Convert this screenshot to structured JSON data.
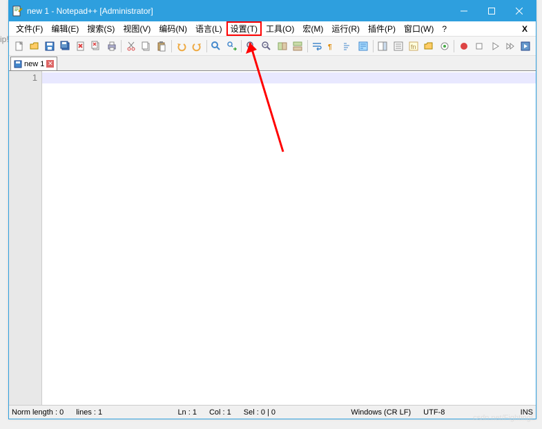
{
  "window": {
    "title": "new 1 - Notepad++ [Administrator]"
  },
  "menubar": {
    "items": [
      {
        "label": "文件(F)"
      },
      {
        "label": "编辑(E)"
      },
      {
        "label": "搜索(S)"
      },
      {
        "label": "视图(V)"
      },
      {
        "label": "编码(N)"
      },
      {
        "label": "语言(L)"
      },
      {
        "label": "设置(T)",
        "highlighted": true
      },
      {
        "label": "工具(O)"
      },
      {
        "label": "宏(M)"
      },
      {
        "label": "运行(R)"
      },
      {
        "label": "插件(P)"
      },
      {
        "label": "窗口(W)"
      },
      {
        "label": "?"
      }
    ],
    "close_x": "X"
  },
  "toolbar_icons": [
    "new",
    "open",
    "save",
    "save-all",
    "close",
    "close-all",
    "print",
    "",
    "cut",
    "copy",
    "paste",
    "",
    "undo",
    "redo",
    "",
    "find",
    "replace",
    "",
    "zoom-in",
    "zoom-out",
    "sync",
    "",
    "word-wrap",
    "show-all",
    "indent-guide",
    "",
    "lang",
    "monitor",
    "",
    "folder",
    "doc-new",
    "doc-list",
    "bookmark",
    "",
    "record",
    "stop",
    "play",
    "fast",
    "",
    "toggle"
  ],
  "tabs": [
    {
      "label": "new 1"
    }
  ],
  "editor": {
    "line_number": "1"
  },
  "statusbar": {
    "left1": "Norm length : 0",
    "left2": "lines : 1",
    "ln": "Ln : 1",
    "col": "Col : 1",
    "sel": "Sel : 0 | 0",
    "eol": "Windows (CR LF)",
    "encoding": "UTF-8",
    "mode": "INS"
  },
  "watermark": "csdn.net/FightingL"
}
